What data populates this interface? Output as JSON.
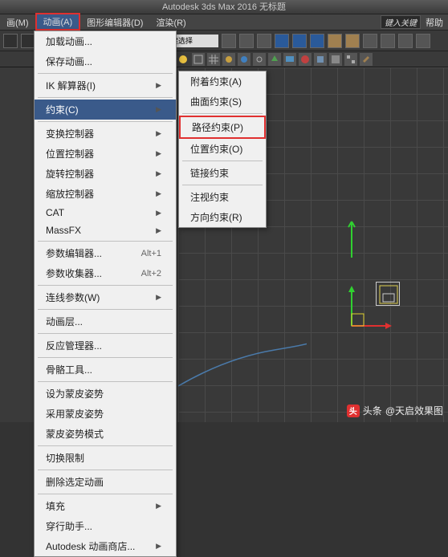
{
  "title": "Autodesk 3ds Max 2016     无标题",
  "menubar": {
    "items": [
      "画(M)",
      "动画(A)",
      "图形编辑器(D)",
      "渲染(R)"
    ],
    "keyin": "键入关键",
    "help": "帮助"
  },
  "toolbar": {
    "dropdown": "创建选择"
  },
  "main_menu": {
    "items": [
      {
        "label": "加载动画...",
        "sep": false
      },
      {
        "label": "保存动画...",
        "sep": true
      },
      {
        "label": "IK 解算器(I)",
        "arrow": true,
        "sep": true
      },
      {
        "label": "约束(C)",
        "arrow": true,
        "hl": true,
        "sep": true
      },
      {
        "label": "变换控制器",
        "arrow": true
      },
      {
        "label": "位置控制器",
        "arrow": true
      },
      {
        "label": "旋转控制器",
        "arrow": true
      },
      {
        "label": "缩放控制器",
        "arrow": true
      },
      {
        "label": "CAT",
        "arrow": true
      },
      {
        "label": "MassFX",
        "arrow": true,
        "sep": true
      },
      {
        "label": "参数编辑器...",
        "shortcut": "Alt+1"
      },
      {
        "label": "参数收集器...",
        "shortcut": "Alt+2",
        "sep": true
      },
      {
        "label": "连线参数(W)",
        "arrow": true,
        "sep": true
      },
      {
        "label": "动画层...",
        "sep": true
      },
      {
        "label": "反应管理器...",
        "sep": true
      },
      {
        "label": "骨骼工具...",
        "sep": true
      },
      {
        "label": "设为蒙皮姿势"
      },
      {
        "label": "采用蒙皮姿势"
      },
      {
        "label": "蒙皮姿势模式",
        "sep": true
      },
      {
        "label": "切换限制",
        "sep": true
      },
      {
        "label": "删除选定动画",
        "sep": true
      },
      {
        "label": "填充",
        "arrow": true
      },
      {
        "label": "穿行助手..."
      },
      {
        "label": "Autodesk 动画商店...",
        "arrow": true
      }
    ]
  },
  "sub_menu": {
    "items": [
      {
        "label": "附着约束(A)"
      },
      {
        "label": "曲面约束(S)",
        "sep": true
      },
      {
        "label": "路径约束(P)",
        "boxed": true
      },
      {
        "label": "位置约束(O)",
        "sep": true
      },
      {
        "label": "链接约束",
        "sep": true
      },
      {
        "label": "注视约束"
      },
      {
        "label": "方向约束(R)"
      }
    ]
  },
  "watermark": {
    "prefix": "头条",
    "author": "@天启效果图"
  }
}
